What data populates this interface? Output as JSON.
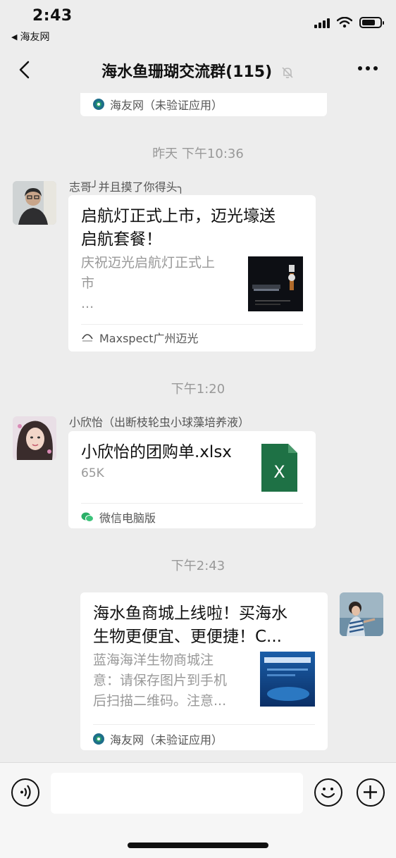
{
  "status": {
    "time": "2:43",
    "back_app": "海友网"
  },
  "nav": {
    "title": "海水鱼珊瑚交流群(115)"
  },
  "messages": {
    "top_card": {
      "source": "海友网（未验证应用）"
    },
    "ts1": "昨天 下午10:36",
    "msg1": {
      "sender": "志哥╯并且摸了你得头╮",
      "title_line1": "启航灯正式上市，迈光壕送",
      "title_line2": "启航套餐！",
      "desc_line1": "庆祝迈光启航灯正式上",
      "desc_line2": "市",
      "desc_line3": "...",
      "source": "Maxspect广州迈光"
    },
    "ts2": "下午1:20",
    "msg2": {
      "sender": "小欣怡（出断枝轮虫小球藻培养液）",
      "file_name": "小欣怡的团购单.xlsx",
      "file_size": "65K",
      "file_icon_letter": "X",
      "source": "微信电脑版"
    },
    "ts3": "下午2:43",
    "msg3": {
      "title_line1": "海水鱼商城上线啦！买海水",
      "title_line2": "生物更便宜、更便捷！C...",
      "desc_line1": "蓝海海洋生物商城注",
      "desc_line2": "意：请保存图片到手机",
      "desc_line3": "后扫描二维码。注意...",
      "source": "海友网（未验证应用）"
    }
  },
  "colors": {
    "excel_green": "#1e7145",
    "background": "#ededed"
  }
}
